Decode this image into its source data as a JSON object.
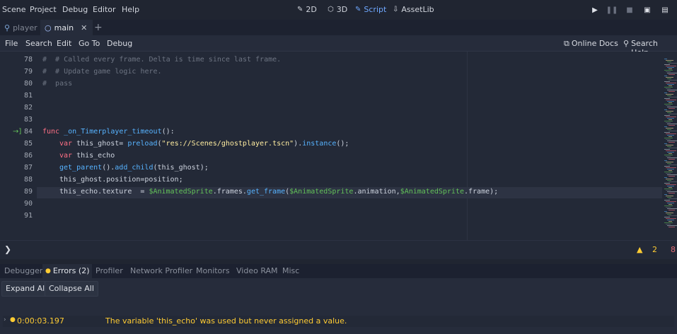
{
  "menu": [
    "Scene",
    "Project",
    "Debug",
    "Editor",
    "Help"
  ],
  "workspaces": [
    {
      "label": "2D",
      "icon": "2d-icon",
      "active": false
    },
    {
      "label": "3D",
      "icon": "3d-icon",
      "active": false
    },
    {
      "label": "Script",
      "icon": "script-icon",
      "active": true
    },
    {
      "label": "AssetLib",
      "icon": "assetlib-icon",
      "active": false
    }
  ],
  "scene_tabs": [
    {
      "label": "player",
      "active": false
    },
    {
      "label": "main",
      "active": true
    }
  ],
  "script_menu": [
    "File",
    "Search",
    "Edit",
    "Go To",
    "Debug"
  ],
  "script_links": {
    "online_docs": "Online Docs",
    "search_help": "Search Help"
  },
  "code_lines": [
    {
      "num": "78",
      "text": "#\t# Called every frame. Delta is time since last frame."
    },
    {
      "num": "79",
      "text": "#\t# Update game logic here."
    },
    {
      "num": "80",
      "text": "#\tpass"
    },
    {
      "num": "81",
      "text": ""
    },
    {
      "num": "82",
      "text": ""
    },
    {
      "num": "83",
      "text": ""
    },
    {
      "num": "84",
      "text": "func _on_Timerplayer_timeout():"
    },
    {
      "num": "85",
      "text": "var this_ghost= preload(\"res://Scenes/ghostplayer.tscn\").instance();"
    },
    {
      "num": "86",
      "text": "var this_echo"
    },
    {
      "num": "87",
      "text": "get_parent().add_child(this_ghost);"
    },
    {
      "num": "88",
      "text": "this_ghost.position=position;"
    },
    {
      "num": "89",
      "text": "this_echo.texture  = $AnimatedSprite.frames.get_frame($AnimatedSprite.animation,$AnimatedSprite.frame);"
    },
    {
      "num": "90",
      "text": ""
    },
    {
      "num": "91",
      "text": ""
    }
  ],
  "status": {
    "prompt": "❯",
    "warnings": "2",
    "errors": "8"
  },
  "bottom_tabs": [
    {
      "label": "Debugger",
      "active": false
    },
    {
      "label": "Errors (2)",
      "active": true
    },
    {
      "label": "Profiler",
      "active": false
    },
    {
      "label": "Network Profiler",
      "active": false
    },
    {
      "label": "Monitors",
      "active": false
    },
    {
      "label": "Video RAM",
      "active": false
    },
    {
      "label": "Misc",
      "active": false
    }
  ],
  "errors_panel": {
    "expand_all": "Expand All",
    "collapse_all": "Collapse All",
    "entries": [
      {
        "time": "0:00:03.197",
        "message": "The variable 'this_echo' was used but never assigned a value."
      }
    ]
  },
  "colors": {
    "accent": "#6fa8ff",
    "keyword": "#ff7085",
    "function": "#57b3ff",
    "string": "#ffeda1",
    "node_path": "#63c259",
    "warning": "#ffcc33"
  }
}
